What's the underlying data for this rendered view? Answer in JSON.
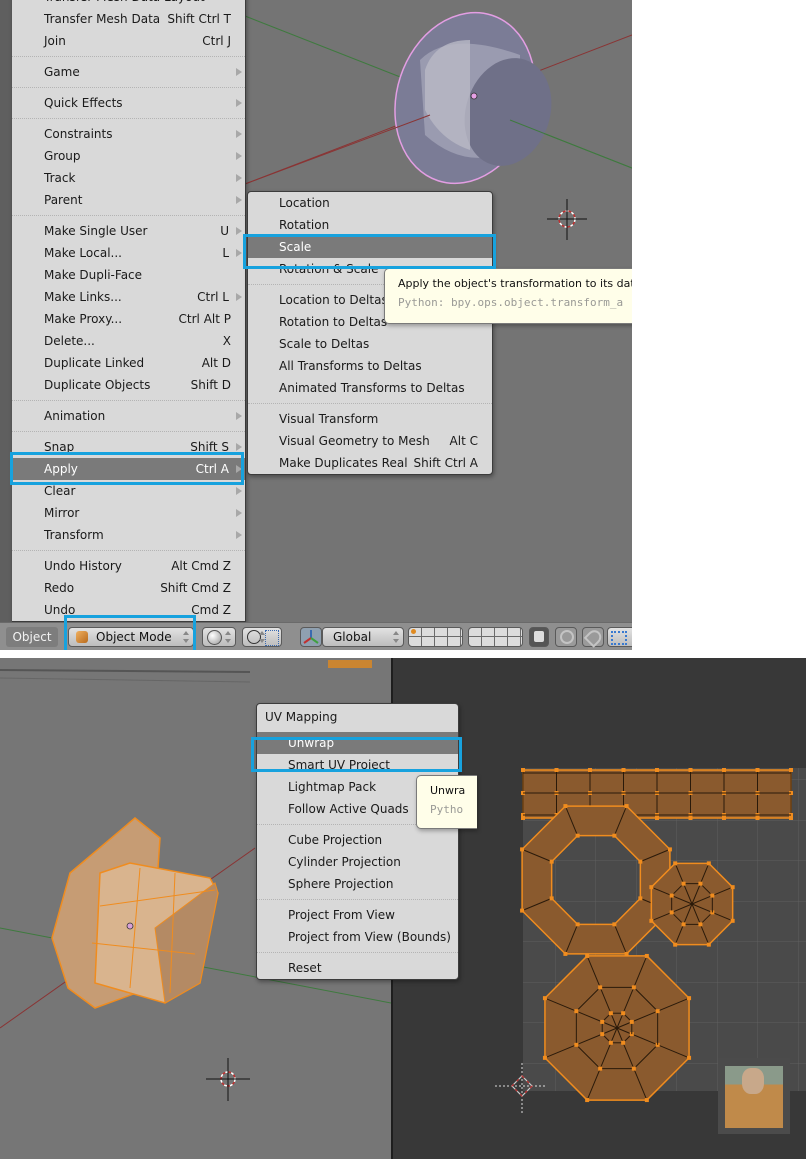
{
  "top_panel": {
    "object_menu": {
      "items": [
        {
          "label": "Transfer Mesh Data Layout",
          "shortcut": "",
          "submenu": false,
          "sep_after": false
        },
        {
          "label": "Transfer Mesh Data",
          "shortcut": "Shift Ctrl T",
          "submenu": false,
          "sep_after": false
        },
        {
          "label": "Join",
          "shortcut": "Ctrl J",
          "submenu": false,
          "sep_after": true
        },
        {
          "label": "Game",
          "shortcut": "",
          "submenu": true,
          "sep_after": true
        },
        {
          "label": "Quick Effects",
          "shortcut": "",
          "submenu": true,
          "sep_after": true
        },
        {
          "label": "Constraints",
          "shortcut": "",
          "submenu": true,
          "sep_after": false
        },
        {
          "label": "Group",
          "shortcut": "",
          "submenu": true,
          "sep_after": false
        },
        {
          "label": "Track",
          "shortcut": "",
          "submenu": true,
          "sep_after": false
        },
        {
          "label": "Parent",
          "shortcut": "",
          "submenu": true,
          "sep_after": true
        },
        {
          "label": "Make Single User",
          "shortcut": "U",
          "submenu": true,
          "sep_after": false
        },
        {
          "label": "Make Local...",
          "shortcut": "L",
          "submenu": true,
          "sep_after": false
        },
        {
          "label": "Make Dupli-Face",
          "shortcut": "",
          "submenu": false,
          "sep_after": false
        },
        {
          "label": "Make Links...",
          "shortcut": "Ctrl L",
          "submenu": true,
          "sep_after": false
        },
        {
          "label": "Make Proxy...",
          "shortcut": "Ctrl Alt P",
          "submenu": false,
          "sep_after": false
        },
        {
          "label": "Delete...",
          "shortcut": "X",
          "submenu": false,
          "sep_after": false
        },
        {
          "label": "Duplicate Linked",
          "shortcut": "Alt D",
          "submenu": false,
          "sep_after": false
        },
        {
          "label": "Duplicate Objects",
          "shortcut": "Shift D",
          "submenu": false,
          "sep_after": true
        },
        {
          "label": "Animation",
          "shortcut": "",
          "submenu": true,
          "sep_after": true
        },
        {
          "label": "Snap",
          "shortcut": "Shift S",
          "submenu": true,
          "sep_after": false
        },
        {
          "label": "Apply",
          "shortcut": "Ctrl A",
          "submenu": true,
          "sep_after": false,
          "highlighted": true
        },
        {
          "label": "Clear",
          "shortcut": "",
          "submenu": true,
          "sep_after": false
        },
        {
          "label": "Mirror",
          "shortcut": "",
          "submenu": true,
          "sep_after": false
        },
        {
          "label": "Transform",
          "shortcut": "",
          "submenu": true,
          "sep_after": true
        },
        {
          "label": "Undo History",
          "shortcut": "Alt Cmd Z",
          "submenu": false,
          "sep_after": false
        },
        {
          "label": "Redo",
          "shortcut": "Shift Cmd Z",
          "submenu": false,
          "sep_after": false
        },
        {
          "label": "Undo",
          "shortcut": "Cmd Z",
          "submenu": false,
          "sep_after": false
        }
      ]
    },
    "apply_submenu": {
      "items": [
        {
          "label": "Location",
          "shortcut": "",
          "sep_after": false
        },
        {
          "label": "Rotation",
          "shortcut": "",
          "sep_after": false
        },
        {
          "label": "Scale",
          "shortcut": "",
          "sep_after": false,
          "highlighted": true
        },
        {
          "label": "Rotation & Scale",
          "shortcut": "",
          "sep_after": true
        },
        {
          "label": "Location to Deltas",
          "shortcut": "",
          "sep_after": false
        },
        {
          "label": "Rotation to Deltas",
          "shortcut": "",
          "sep_after": false
        },
        {
          "label": "Scale to Deltas",
          "shortcut": "",
          "sep_after": false
        },
        {
          "label": "All Transforms to Deltas",
          "shortcut": "",
          "sep_after": false
        },
        {
          "label": "Animated Transforms to Deltas",
          "shortcut": "",
          "sep_after": true
        },
        {
          "label": "Visual Transform",
          "shortcut": "",
          "sep_after": false
        },
        {
          "label": "Visual Geometry to Mesh",
          "shortcut": "Alt C",
          "sep_after": false
        },
        {
          "label": "Make Duplicates Real",
          "shortcut": "Shift Ctrl A",
          "sep_after": false
        }
      ]
    },
    "tooltip": {
      "description": "Apply the object's transformation to its dat",
      "python": "Python: bpy.ops.object.transform_a"
    },
    "header": {
      "menu_label": "Object",
      "mode_value": "Object Mode",
      "orientation_value": "Global",
      "icons": [
        "mode-cube-icon",
        "viewport-shading-icon",
        "pivot-point-icon",
        "manipulator-icon",
        "transform-axes-icon",
        "layers-grid",
        "lock-layers-icon",
        "proportional-edit-icon",
        "snap-icon",
        "snap-target-icon"
      ]
    },
    "accent_color": "#17a2de"
  },
  "bottom_panel": {
    "uv_menu": {
      "title": "UV Mapping",
      "items": [
        {
          "label": "Unwrap",
          "sep_after": false,
          "highlighted": true
        },
        {
          "label": "Smart UV Project",
          "sep_after": false
        },
        {
          "label": "Lightmap Pack",
          "sep_after": false
        },
        {
          "label": "Follow Active Quads",
          "sep_after": true
        },
        {
          "label": "Cube Projection",
          "sep_after": false
        },
        {
          "label": "Cylinder Projection",
          "sep_after": false
        },
        {
          "label": "Sphere Projection",
          "sep_after": true
        },
        {
          "label": "Project From View",
          "sep_after": false
        },
        {
          "label": "Project from View (Bounds)",
          "sep_after": true
        },
        {
          "label": "Reset",
          "sep_after": false
        }
      ]
    },
    "tooltip": {
      "description": "Unwra",
      "python": "Pytho"
    },
    "uv_color": "#8a5a2e",
    "uv_edge_color": "#f08c1e"
  }
}
